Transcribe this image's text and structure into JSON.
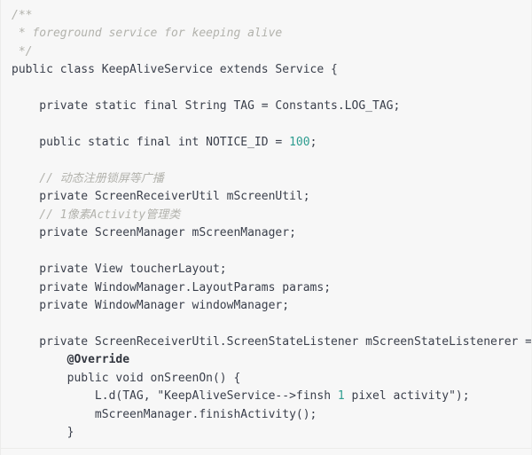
{
  "editor": {
    "language": "java",
    "theme_background": "#f7f7f7",
    "colors": {
      "code": "#3a3f4b",
      "comment": "#b2b2ac",
      "number": "#2e9d90",
      "annotation": "#32363f",
      "background": "#f7f7f7"
    }
  },
  "code_lines": [
    {
      "indent": 0,
      "tokens": [
        {
          "t": "cmt",
          "s": "/**"
        }
      ]
    },
    {
      "indent": 0,
      "tokens": [
        {
          "t": "cmt",
          "s": " * foreground service for keeping alive"
        }
      ]
    },
    {
      "indent": 0,
      "tokens": [
        {
          "t": "cmt",
          "s": " */"
        }
      ]
    },
    {
      "indent": 0,
      "tokens": [
        {
          "t": "code",
          "s": "public class KeepAliveService extends Service {"
        }
      ]
    },
    {
      "indent": 0,
      "tokens": []
    },
    {
      "indent": 0,
      "tokens": [
        {
          "t": "code",
          "s": "    private static final String TAG = Constants.LOG_TAG;"
        }
      ]
    },
    {
      "indent": 0,
      "tokens": []
    },
    {
      "indent": 0,
      "tokens": [
        {
          "t": "code",
          "s": "    public static final int NOTICE_ID = "
        },
        {
          "t": "num",
          "s": "100"
        },
        {
          "t": "code",
          "s": ";"
        }
      ]
    },
    {
      "indent": 0,
      "tokens": []
    },
    {
      "indent": 0,
      "tokens": [
        {
          "t": "cmt",
          "s": "    // 动态注册锁屏等广播"
        }
      ]
    },
    {
      "indent": 0,
      "tokens": [
        {
          "t": "code",
          "s": "    private ScreenReceiverUtil mScreenUtil;"
        }
      ]
    },
    {
      "indent": 0,
      "tokens": [
        {
          "t": "cmt",
          "s": "    // 1像素Activity管理类"
        }
      ]
    },
    {
      "indent": 0,
      "tokens": [
        {
          "t": "code",
          "s": "    private ScreenManager mScreenManager;"
        }
      ]
    },
    {
      "indent": 0,
      "tokens": []
    },
    {
      "indent": 0,
      "tokens": [
        {
          "t": "code",
          "s": "    private View toucherLayout;"
        }
      ]
    },
    {
      "indent": 0,
      "tokens": [
        {
          "t": "code",
          "s": "    private WindowManager.LayoutParams params;"
        }
      ]
    },
    {
      "indent": 0,
      "tokens": [
        {
          "t": "code",
          "s": "    private WindowManager windowManager;"
        }
      ]
    },
    {
      "indent": 0,
      "tokens": []
    },
    {
      "indent": 0,
      "tokens": [
        {
          "t": "code",
          "s": "    private ScreenReceiverUtil.ScreenStateListener mScreenStateListenerer = new ScreenRecei"
        }
      ]
    },
    {
      "indent": 0,
      "tokens": [
        {
          "t": "anno",
          "s": "        @Override"
        }
      ]
    },
    {
      "indent": 0,
      "tokens": [
        {
          "t": "code",
          "s": "        public void onSreenOn() {"
        }
      ]
    },
    {
      "indent": 0,
      "tokens": [
        {
          "t": "code",
          "s": "            L.d(TAG, \"KeepAliveService-->finsh "
        },
        {
          "t": "num",
          "s": "1"
        },
        {
          "t": "code",
          "s": " pixel activity\");"
        }
      ]
    },
    {
      "indent": 0,
      "tokens": [
        {
          "t": "code",
          "s": "            mScreenManager.finishActivity();"
        }
      ]
    },
    {
      "indent": 0,
      "tokens": [
        {
          "t": "code",
          "s": "        }"
        }
      ]
    }
  ]
}
